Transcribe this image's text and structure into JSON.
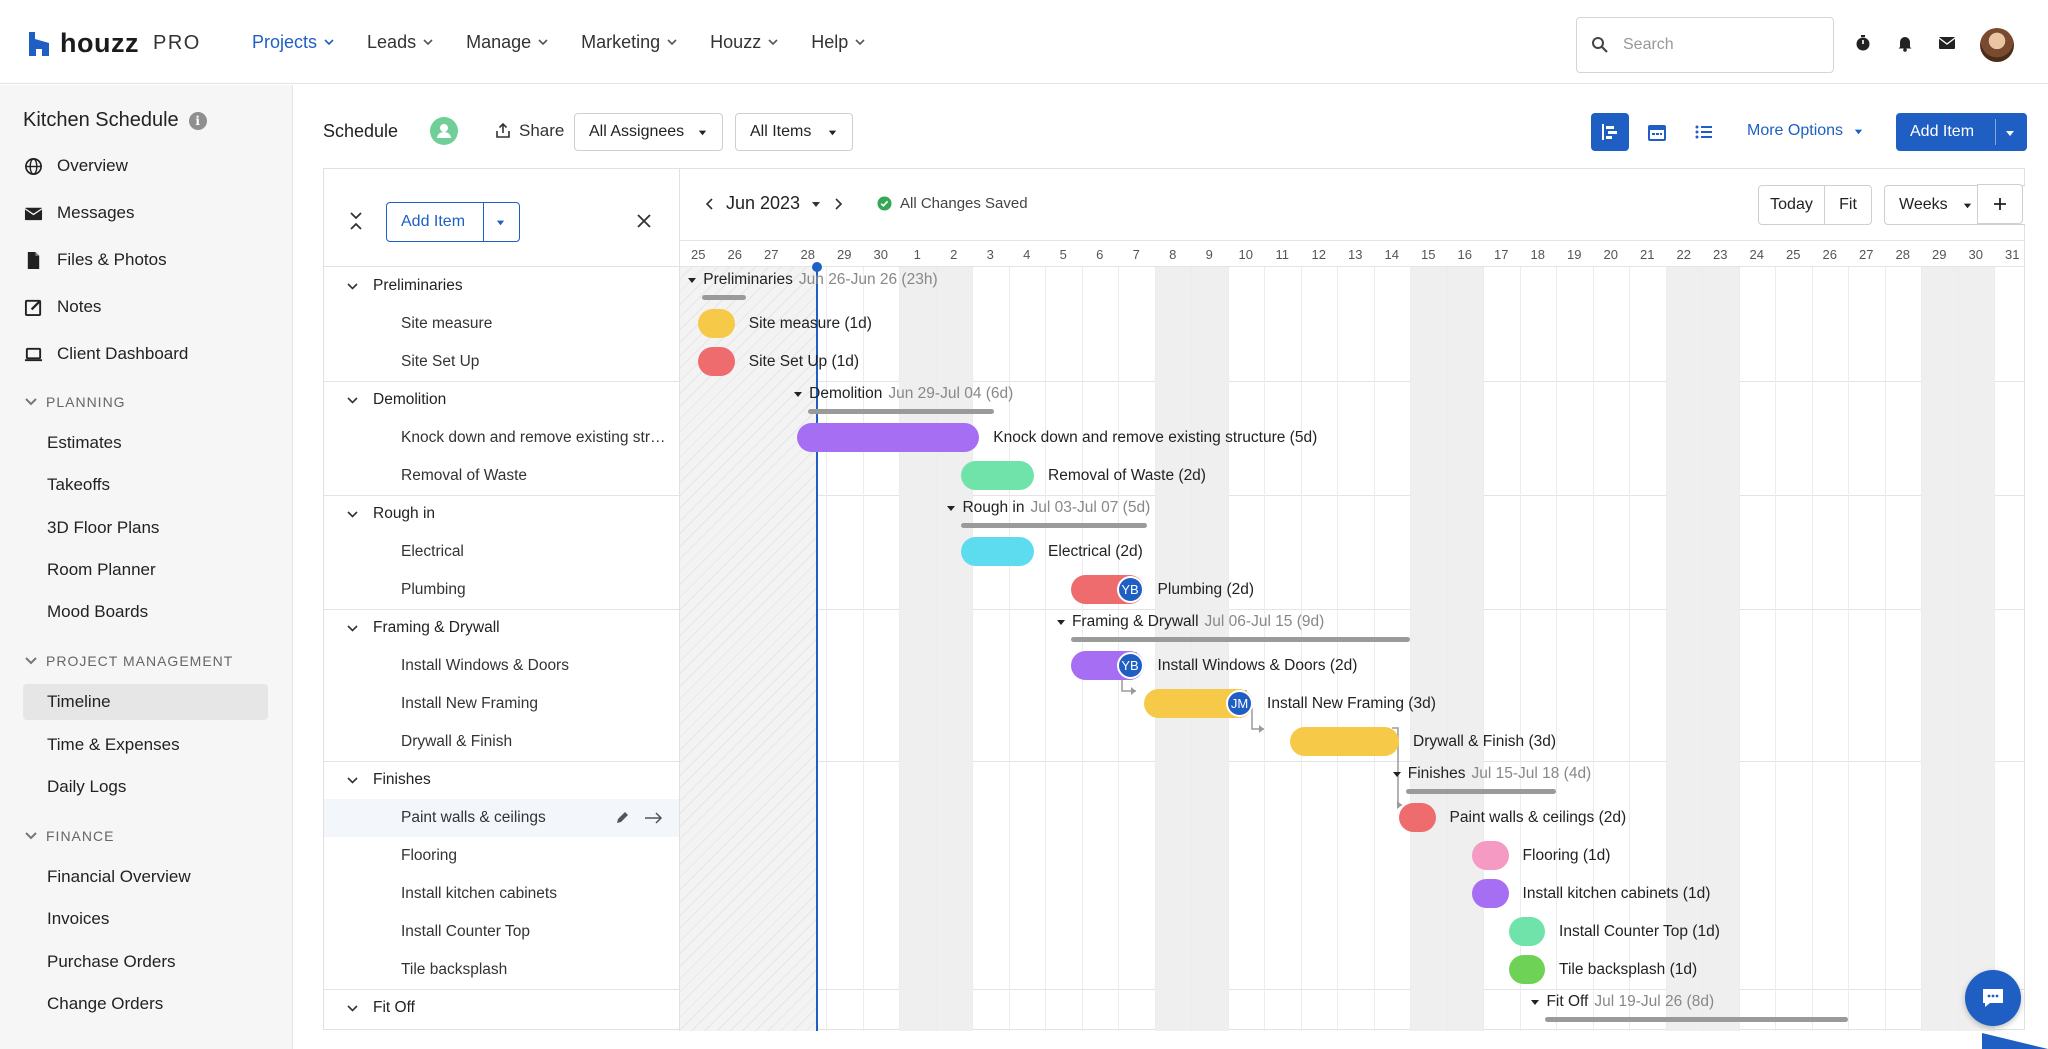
{
  "brand": {
    "word": "houzz",
    "pro": "PRO"
  },
  "nav": [
    {
      "label": "Projects",
      "active": true
    },
    {
      "label": "Leads"
    },
    {
      "label": "Manage"
    },
    {
      "label": "Marketing"
    },
    {
      "label": "Houzz"
    },
    {
      "label": "Help"
    }
  ],
  "search": {
    "placeholder": "Search"
  },
  "sidebar": {
    "project_title": "Kitchen Schedule",
    "items": [
      "Overview",
      "Messages",
      "Files & Photos",
      "Notes",
      "Client Dashboard"
    ],
    "sections": [
      {
        "title": "PLANNING",
        "items": [
          "Estimates",
          "Takeoffs",
          "3D Floor Plans",
          "Room Planner",
          "Mood Boards"
        ]
      },
      {
        "title": "PROJECT MANAGEMENT",
        "items": [
          "Timeline",
          "Time & Expenses",
          "Daily Logs"
        ]
      },
      {
        "title": "FINANCE",
        "items": [
          "Financial Overview",
          "Invoices",
          "Purchase Orders",
          "Change Orders"
        ]
      }
    ],
    "active": "Timeline"
  },
  "schedule": {
    "title": "Schedule",
    "share": "Share",
    "assignees": "All Assignees",
    "items_filter": "All Items",
    "more_options": "More Options",
    "add_item": "Add Item"
  },
  "left_pane": {
    "add_item": "Add Item"
  },
  "toolbar": {
    "month": "Jun 2023",
    "saved": "All Changes Saved",
    "today": "Today",
    "fit": "Fit",
    "scale": "Weeks"
  },
  "days": [
    "25",
    "26",
    "27",
    "28",
    "29",
    "30",
    "1",
    "2",
    "3",
    "4",
    "5",
    "6",
    "7",
    "8",
    "9",
    "10",
    "11",
    "12",
    "13",
    "14",
    "15",
    "16",
    "17",
    "18",
    "19",
    "20",
    "21",
    "22",
    "23",
    "24",
    "25",
    "26",
    "27",
    "28",
    "29",
    "30",
    "31"
  ],
  "groups": [
    {
      "name": "Preliminaries",
      "dates": "Jun 26-Jun 26 (23h)",
      "tasks": [
        {
          "name": "Site measure",
          "bar": "Site measure (1d)",
          "color": "#f7c948"
        },
        {
          "name": "Site Set Up",
          "bar": "Site Set Up (1d)",
          "color": "#ee6b6e"
        }
      ]
    },
    {
      "name": "Demolition",
      "dates": "Jun 29-Jul 04 (6d)",
      "tasks": [
        {
          "name": "Knock down and remove existing structure",
          "bar": "Knock down and remove existing structure (5d)",
          "color": "#a66ef2"
        },
        {
          "name": "Removal of Waste",
          "bar": "Removal of Waste (2d)",
          "color": "#6fe3a9"
        }
      ]
    },
    {
      "name": "Rough in",
      "dates": "Jul 03-Jul 07 (5d)",
      "tasks": [
        {
          "name": "Electrical",
          "bar": "Electrical (2d)",
          "color": "#5ddcf0"
        },
        {
          "name": "Plumbing",
          "bar": "Plumbing (2d)",
          "color": "#ee6b6e",
          "assignee": "YB"
        }
      ]
    },
    {
      "name": "Framing & Drywall",
      "dates": "Jul 06-Jul 15 (9d)",
      "tasks": [
        {
          "name": "Install Windows & Doors",
          "bar": "Install Windows & Doors (2d)",
          "color": "#a66ef2",
          "assignee": "YB"
        },
        {
          "name": "Install New Framing",
          "bar": "Install New Framing (3d)",
          "color": "#f7c948",
          "assignee": "JM"
        },
        {
          "name": "Drywall & Finish",
          "bar": "Drywall & Finish (3d)",
          "color": "#f7c948"
        }
      ]
    },
    {
      "name": "Finishes",
      "dates": "Jul 15-Jul 18 (4d)",
      "tasks": [
        {
          "name": "Paint walls & ceilings",
          "bar": "Paint walls & ceilings (2d)",
          "color": "#ee6b6e"
        },
        {
          "name": "Flooring",
          "bar": "Flooring (1d)",
          "color": "#f59ac3"
        },
        {
          "name": "Install kitchen cabinets",
          "bar": "Install kitchen cabinets (1d)",
          "color": "#a66ef2"
        },
        {
          "name": "Install Counter Top",
          "bar": "Install Counter Top (1d)",
          "color": "#6fe3a9"
        },
        {
          "name": "Tile backsplash",
          "bar": "Tile backsplash (1d)",
          "color": "#6ed257"
        }
      ]
    },
    {
      "name": "Fit Off",
      "dates": "Jul 19-Jul 26 (8d)",
      "tasks": []
    }
  ],
  "colors": {
    "accent": "#1f5fc4",
    "saved": "#34a853"
  }
}
